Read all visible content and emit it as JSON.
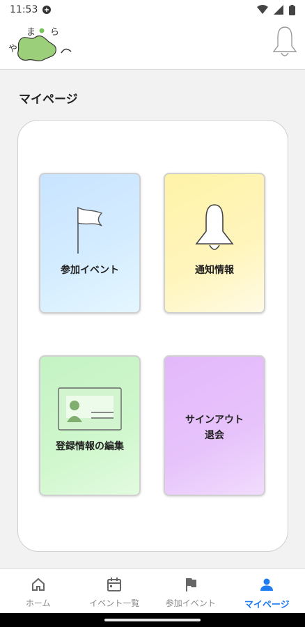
{
  "status_bar": {
    "time": "11:53"
  },
  "header": {
    "logo_icon": "app-logo",
    "bell_icon": "bell-icon"
  },
  "page": {
    "title": "マイページ"
  },
  "menu": {
    "tiles": [
      {
        "label": "参加イベント",
        "icon": "flag-icon",
        "color": "#cfe9ff"
      },
      {
        "label": "通知情報",
        "icon": "bell-icon",
        "color": "#fff4b0"
      },
      {
        "label": "登録情報の編集",
        "icon": "id-card-icon",
        "color": "#caf5c8"
      },
      {
        "label": "サインアウト\n退会",
        "icon": "none",
        "color": "#e6c0fb"
      }
    ]
  },
  "bottom_nav": {
    "items": [
      {
        "label": "ホーム",
        "icon": "home-icon"
      },
      {
        "label": "イベント一覧",
        "icon": "calendar-icon"
      },
      {
        "label": "参加イベント",
        "icon": "flag-icon"
      },
      {
        "label": "マイページ",
        "icon": "person-icon",
        "active": true
      }
    ],
    "active_color": "#1d7cf2"
  }
}
